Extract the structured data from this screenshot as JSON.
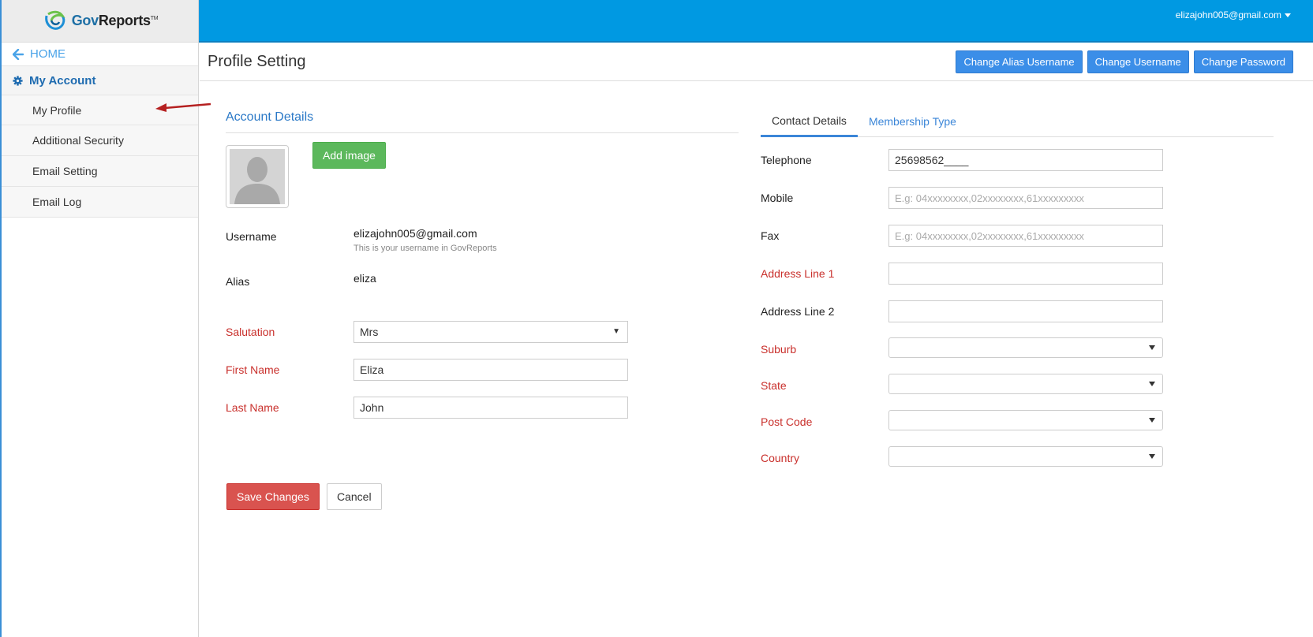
{
  "brand": {
    "name_part1": "Gov",
    "name_part2": "Reports",
    "tm": "TM"
  },
  "topbar": {
    "user_email": "elizajohn005@gmail.com"
  },
  "sidebar": {
    "home_label": "HOME",
    "account_label": "My Account",
    "items": [
      {
        "label": "My Profile"
      },
      {
        "label": "Additional Security"
      },
      {
        "label": "Email Setting"
      },
      {
        "label": "Email Log"
      }
    ]
  },
  "header": {
    "title": "Profile Setting",
    "buttons": {
      "change_alias": "Change Alias Username",
      "change_username": "Change Username",
      "change_password": "Change Password"
    }
  },
  "account": {
    "section_title": "Account Details",
    "add_image_label": "Add image",
    "username_label": "Username",
    "username_value": "elizajohn005@gmail.com",
    "username_hint": "This is your username in GovReports",
    "alias_label": "Alias",
    "alias_value": "eliza",
    "salutation_label": "Salutation",
    "salutation_value": "Mrs",
    "first_name_label": "First Name",
    "first_name_value": "Eliza",
    "last_name_label": "Last Name",
    "last_name_value": "John",
    "save_label": "Save Changes",
    "cancel_label": "Cancel"
  },
  "contact": {
    "tabs": [
      {
        "label": "Contact Details"
      },
      {
        "label": "Membership Type"
      }
    ],
    "telephone_label": "Telephone",
    "telephone_value": "25698562____",
    "mobile_label": "Mobile",
    "mobile_placeholder": "E.g: 04xxxxxxxx,02xxxxxxxx,61xxxxxxxxx",
    "fax_label": "Fax",
    "fax_placeholder": "E.g: 04xxxxxxxx,02xxxxxxxx,61xxxxxxxxx",
    "address1_label": "Address Line 1",
    "address2_label": "Address Line 2",
    "suburb_label": "Suburb",
    "state_label": "State",
    "postcode_label": "Post Code",
    "country_label": "Country"
  },
  "colors": {
    "topbar": "#0099e2",
    "primary": "#3b8ee8",
    "success": "#5cb85c",
    "danger": "#d9534f",
    "required_label": "#c9302c"
  }
}
